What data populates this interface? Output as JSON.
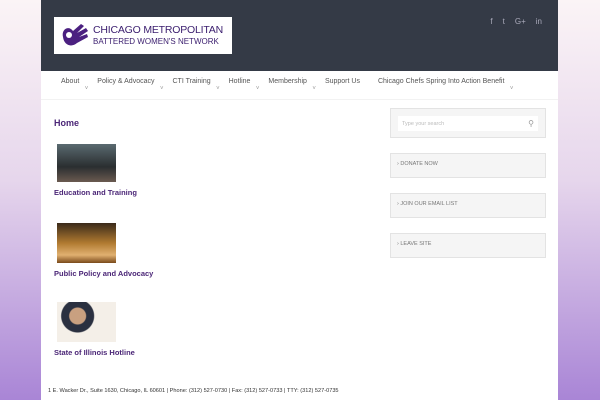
{
  "logo": {
    "line1": "CHICAGO METROPOLITAN",
    "line2": "BATTERED WOMEN'S NETWORK"
  },
  "social": [
    "f",
    "t",
    "G+",
    "in"
  ],
  "nav": [
    "About",
    "Policy & Advocacy",
    "CTI Training",
    "Hotline",
    "Membership",
    "Support Us",
    "Chicago Chefs Spring Into Action Benefit"
  ],
  "nav_caret": "˅",
  "main": {
    "title": "Home",
    "items": [
      {
        "title": "Education and Training"
      },
      {
        "title": "Public Policy and Advocacy"
      },
      {
        "title": "State of Illinois Hotline"
      }
    ]
  },
  "sidebar": {
    "search_placeholder": "Type your search",
    "links": [
      "DONATE NOW",
      "JOIN OUR EMAIL LIST",
      "LEAVE SITE"
    ],
    "bullet": "›"
  },
  "footer": "1 E. Wacker Dr., Suite 1630, Chicago, IL 60601 | Phone: (312) 527-0730 | Fax: (312) 527-0733 | TTY: (312) 527-0735"
}
